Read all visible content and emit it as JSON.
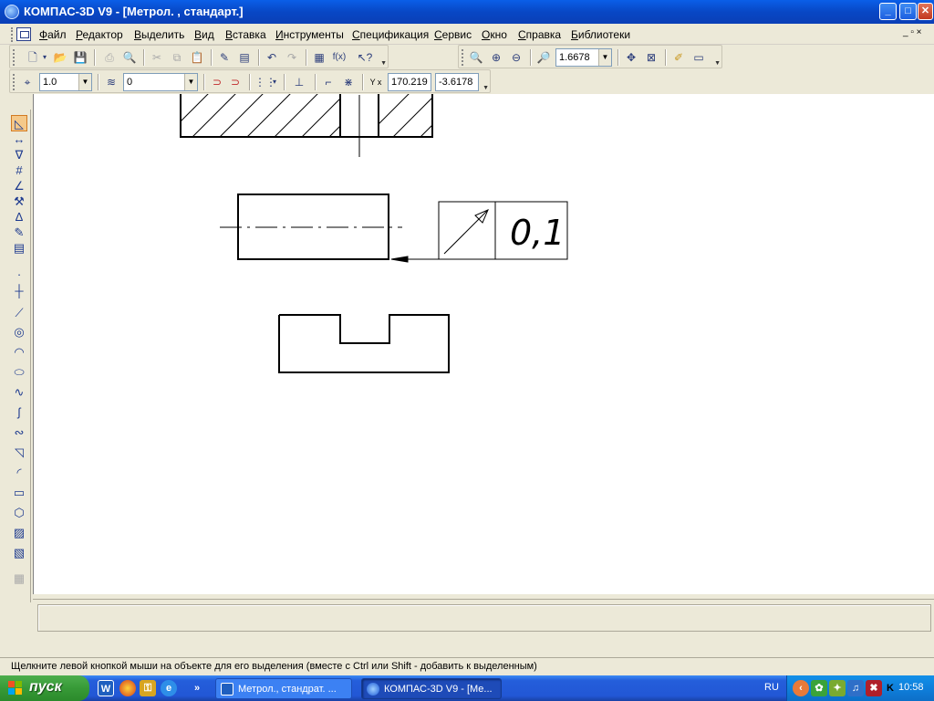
{
  "window": {
    "title": "КОМПАС-3D V9 - [Метрол. , стандарт.]",
    "buttons": {
      "minimize": "_",
      "maximize": "□",
      "close": "✕"
    }
  },
  "menu": {
    "items": [
      "Файл",
      "Редактор",
      "Выделить",
      "Вид",
      "Вставка",
      "Инструменты",
      "Спецификация",
      "Сервис",
      "Окно",
      "Справка",
      "Библиотеки"
    ],
    "mdi_controls": "_ ▫ ×"
  },
  "standard_toolbar": {
    "zoom_value": "1.6678"
  },
  "current_state_toolbar": {
    "step_value": "1.0",
    "layer_value": "0",
    "coord_label": "Y x",
    "coord_x": "170.219",
    "coord_y": "-3.6178"
  },
  "drawing": {
    "tolerance_value": "0,1",
    "tolerance_symbol": "runout-arrow"
  },
  "left_panel": {
    "icons": [
      "geometry-icon",
      "dimensions-icon",
      "designations-icon",
      "edit-icon",
      "parametrization-icon",
      "measure-icon",
      "select-icon",
      "spec-icon",
      "report-icon"
    ]
  },
  "status": {
    "message": "Щелкните левой кнопкой мыши на объекте для его выделения (вместе с Ctrl или Shift - добавить к выделенным)"
  },
  "taskbar": {
    "start_label": "пуск",
    "tasks": [
      {
        "label": "Метрол., стандрат. ...",
        "active": false
      },
      {
        "label": "КОМПАС-3D V9 - [Ме...",
        "active": true
      }
    ],
    "lang": "RU",
    "clock": "10:58",
    "colors": {
      "start": "#379a37",
      "taskbar": "#245edb",
      "tray": "#0f7fdb"
    }
  }
}
